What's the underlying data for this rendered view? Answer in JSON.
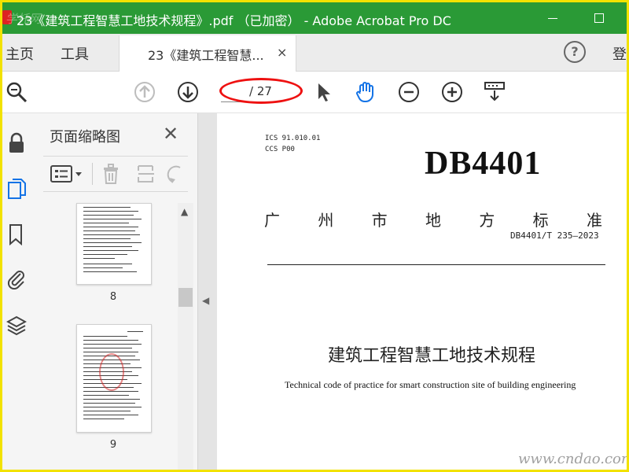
{
  "window": {
    "title": "23《建筑工程智慧工地技术规程》.pdf （已加密） - Adobe Acrobat Pro DC",
    "minimize_icon": "minimize-icon",
    "maximize_icon": "maximize-icon",
    "accent": "#2a9a36"
  },
  "watermark_top_left": "学托网",
  "nav": {
    "home": "主页",
    "tools": "工具",
    "tab_label": "23《建筑工程智慧...",
    "tab_close": "×",
    "help": "?",
    "login": "登"
  },
  "toolbar": {
    "page_current": "",
    "page_total": "/ 27",
    "icons": [
      "search-icon",
      "page-up-icon",
      "page-down-icon",
      "select-cursor-icon",
      "hand-icon",
      "zoom-out-icon",
      "zoom-in-icon",
      "fit-page-icon"
    ]
  },
  "sidebar": {
    "title": "页面缩略图",
    "close": "✕",
    "rail_icons": [
      "lock-icon",
      "pages-icon",
      "bookmark-icon",
      "attachment-icon",
      "layers-icon"
    ]
  },
  "thumbnails": [
    {
      "label": "8"
    },
    {
      "label": "9"
    }
  ],
  "document": {
    "ics": "ICS  91.010.01",
    "ccs": "CCS  P00",
    "standard_code": "DB4401",
    "local_standard_chars": [
      "广",
      "州",
      "市",
      "地",
      "方",
      "标",
      "准"
    ],
    "standard_number": "DB4401/T 235—2023",
    "title_cn": "建筑工程智慧工地技术规程",
    "title_en": "Technical code of practice for smart construction site of building engineering"
  },
  "site_watermark": "www.cndao.com"
}
